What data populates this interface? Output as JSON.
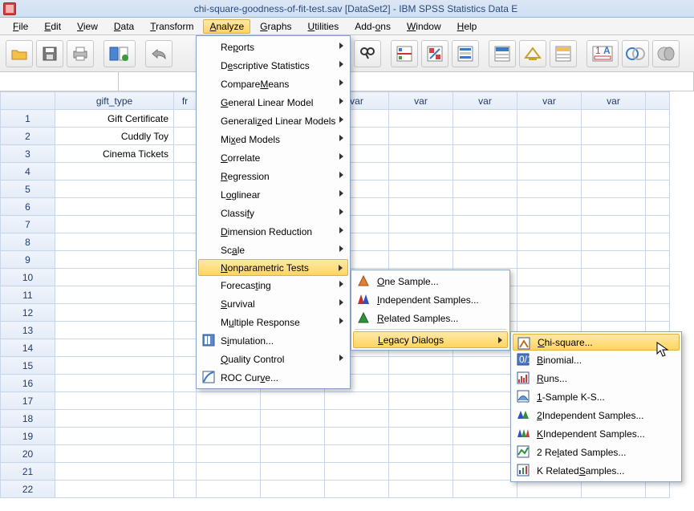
{
  "window": {
    "title": "chi-square-goodness-of-fit-test.sav [DataSet2] - IBM SPSS Statistics Data E"
  },
  "menubar": {
    "file": "File",
    "edit": "Edit",
    "view": "View",
    "data": "Data",
    "transform": "Transform",
    "analyze": "Analyze",
    "graphs": "Graphs",
    "utilities": "Utilities",
    "addons": "Add-ons",
    "window": "Window",
    "help": "Help"
  },
  "columns": {
    "gift_type": "gift_type",
    "freq_prefix": "fr",
    "var": "var"
  },
  "rows": [
    {
      "n": "1",
      "gift": "Gift Certificate"
    },
    {
      "n": "2",
      "gift": "Cuddly Toy"
    },
    {
      "n": "3",
      "gift": "Cinema Tickets"
    },
    {
      "n": "4",
      "gift": ""
    },
    {
      "n": "5"
    },
    {
      "n": "6"
    },
    {
      "n": "7"
    },
    {
      "n": "8"
    },
    {
      "n": "9"
    },
    {
      "n": "10"
    },
    {
      "n": "11"
    },
    {
      "n": "12"
    },
    {
      "n": "13"
    },
    {
      "n": "14"
    },
    {
      "n": "15"
    },
    {
      "n": "16"
    },
    {
      "n": "17"
    },
    {
      "n": "18"
    },
    {
      "n": "19"
    },
    {
      "n": "20"
    },
    {
      "n": "21"
    },
    {
      "n": "22"
    }
  ],
  "analyze_menu": {
    "reports": "Reports",
    "descriptive": "Descriptive Statistics",
    "compare": "Compare Means",
    "glm": "General Linear Model",
    "gzlm": "Generalized Linear Models",
    "mixed": "Mixed Models",
    "correlate": "Correlate",
    "regression": "Regression",
    "loglinear": "Loglinear",
    "classify": "Classify",
    "dimred": "Dimension Reduction",
    "scale": "Scale",
    "nonparam": "Nonparametric Tests",
    "forecast": "Forecasting",
    "survival": "Survival",
    "multresp": "Multiple Response",
    "simulation": "Simulation...",
    "quality": "Quality Control",
    "roc": "ROC Curve..."
  },
  "nonparam_menu": {
    "one": "One Sample...",
    "indep": "Independent Samples...",
    "related": "Related Samples...",
    "legacy": "Legacy Dialogs"
  },
  "legacy_menu": {
    "chisq": "Chi-square...",
    "binomial": "Binomial...",
    "runs": "Runs...",
    "ks1": "1-Sample K-S...",
    "indep2": "2 Independent Samples...",
    "indepk": "K Independent Samples...",
    "rel2": "2 Related Samples...",
    "relk": "K Related Samples..."
  }
}
